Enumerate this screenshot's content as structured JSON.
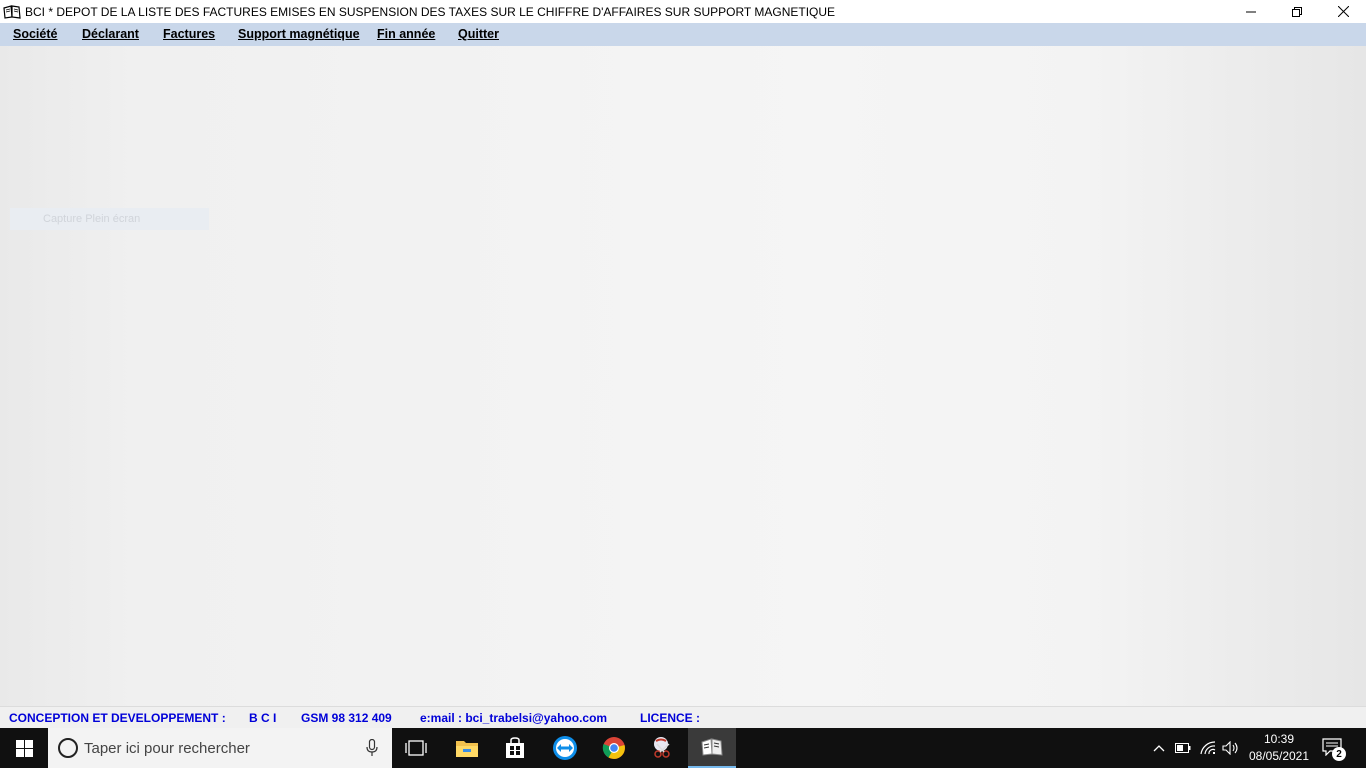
{
  "window": {
    "title": "BCI *   DEPOT DE LA LISTE DES FACTURES EMISES EN SUSPENSION DES TAXES SUR LE CHIFFRE D'AFFAIRES SUR SUPPORT MAGNETIQUE",
    "app_icon": "book-icon"
  },
  "menu": {
    "items": [
      {
        "label": "Société"
      },
      {
        "label": "Déclarant"
      },
      {
        "label": "Factures"
      },
      {
        "label": "Support magnétique"
      },
      {
        "label": "Fin année"
      },
      {
        "label": "Quitter"
      }
    ]
  },
  "main": {
    "ghost_label": "Capture Plein écran"
  },
  "status": {
    "conception": "CONCEPTION ET DEVELOPPEMENT :",
    "company": "B C I",
    "gsm": "GSM 98 312 409",
    "email": "e:mail :  bci_trabelsi@yahoo.com",
    "licence": "LICENCE :"
  },
  "taskbar": {
    "search_placeholder": "Taper ici pour rechercher",
    "time": "10:39",
    "date": "08/05/2021",
    "notification_count": "2"
  },
  "colors": {
    "menubar": "#c9d7ea",
    "status_text": "#0000d8",
    "taskbar": "#101010"
  }
}
